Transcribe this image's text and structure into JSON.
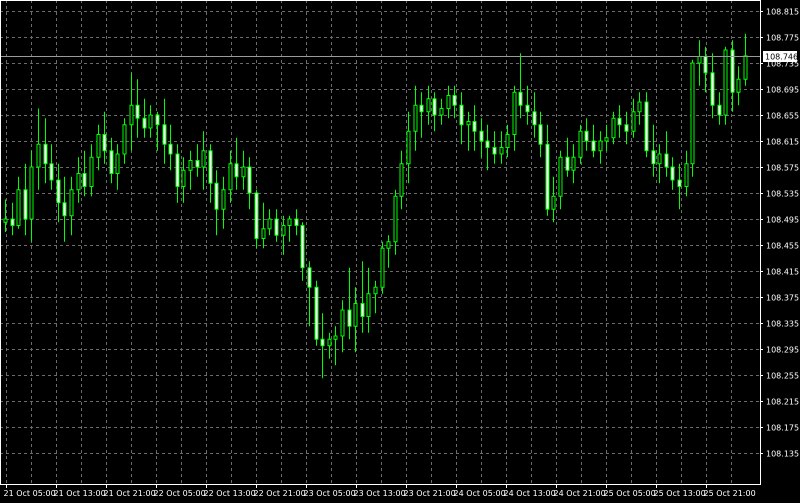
{
  "chart_data": {
    "type": "candlestick",
    "colors": {
      "background": "#000000",
      "grid": "#6b6b6b",
      "axis": "#ffffff",
      "bull_body": "#000000",
      "bull_outline": "#00ff00",
      "bear_body": "#ffffff",
      "bear_outline": "#00ff00",
      "wick": "#00ff00",
      "text": "#ffffff",
      "price_line": "#9a9a9a",
      "price_tag_bg": "#ffffff",
      "price_tag_text": "#000000"
    },
    "grid": true,
    "ylim": [
      108.135,
      108.815
    ],
    "y_ticks": [
      "108.815",
      "108.775",
      "108.735",
      "108.695",
      "108.655",
      "108.615",
      "108.575",
      "108.535",
      "108.495",
      "108.455",
      "108.415",
      "108.375",
      "108.335",
      "108.295",
      "108.255",
      "108.215",
      "108.175",
      "108.135"
    ],
    "x_ticks": [
      "21 Oct 05:00",
      "21 Oct 13:00",
      "21 Oct 21:00",
      "22 Oct 05:00",
      "22 Oct 13:00",
      "22 Oct 21:00",
      "23 Oct 05:00",
      "23 Oct 13:00",
      "23 Oct 21:00",
      "24 Oct 05:00",
      "24 Oct 13:00",
      "24 Oct 21:00",
      "25 Oct 05:00",
      "25 Oct 13:00",
      "25 Oct 21:00"
    ],
    "current_price": "108.746",
    "candles": [
      {
        "o": 108.49,
        "h": 108.525,
        "l": 108.475,
        "c": 108.495
      },
      {
        "o": 108.495,
        "h": 108.52,
        "l": 108.47,
        "c": 108.485
      },
      {
        "o": 108.485,
        "h": 108.56,
        "l": 108.48,
        "c": 108.54
      },
      {
        "o": 108.54,
        "h": 108.58,
        "l": 108.47,
        "c": 108.495
      },
      {
        "o": 108.495,
        "h": 108.6,
        "l": 108.46,
        "c": 108.575
      },
      {
        "o": 108.575,
        "h": 108.665,
        "l": 108.54,
        "c": 108.61
      },
      {
        "o": 108.61,
        "h": 108.65,
        "l": 108.55,
        "c": 108.58
      },
      {
        "o": 108.58,
        "h": 108.61,
        "l": 108.54,
        "c": 108.555
      },
      {
        "o": 108.555,
        "h": 108.58,
        "l": 108.49,
        "c": 108.52
      },
      {
        "o": 108.52,
        "h": 108.56,
        "l": 108.46,
        "c": 108.5
      },
      {
        "o": 108.5,
        "h": 108.56,
        "l": 108.47,
        "c": 108.54
      },
      {
        "o": 108.54,
        "h": 108.59,
        "l": 108.52,
        "c": 108.565
      },
      {
        "o": 108.565,
        "h": 108.6,
        "l": 108.53,
        "c": 108.545
      },
      {
        "o": 108.545,
        "h": 108.61,
        "l": 108.53,
        "c": 108.59
      },
      {
        "o": 108.59,
        "h": 108.64,
        "l": 108.57,
        "c": 108.625
      },
      {
        "o": 108.625,
        "h": 108.66,
        "l": 108.58,
        "c": 108.6
      },
      {
        "o": 108.6,
        "h": 108.62,
        "l": 108.55,
        "c": 108.565
      },
      {
        "o": 108.565,
        "h": 108.61,
        "l": 108.54,
        "c": 108.595
      },
      {
        "o": 108.595,
        "h": 108.65,
        "l": 108.58,
        "c": 108.64
      },
      {
        "o": 108.64,
        "h": 108.72,
        "l": 108.6,
        "c": 108.67
      },
      {
        "o": 108.67,
        "h": 108.71,
        "l": 108.62,
        "c": 108.65
      },
      {
        "o": 108.65,
        "h": 108.68,
        "l": 108.62,
        "c": 108.635
      },
      {
        "o": 108.635,
        "h": 108.67,
        "l": 108.62,
        "c": 108.655
      },
      {
        "o": 108.655,
        "h": 108.66,
        "l": 108.6,
        "c": 108.64
      },
      {
        "o": 108.64,
        "h": 108.68,
        "l": 108.58,
        "c": 108.61
      },
      {
        "o": 108.61,
        "h": 108.64,
        "l": 108.57,
        "c": 108.595
      },
      {
        "o": 108.595,
        "h": 108.61,
        "l": 108.52,
        "c": 108.545
      },
      {
        "o": 108.545,
        "h": 108.59,
        "l": 108.52,
        "c": 108.57
      },
      {
        "o": 108.57,
        "h": 108.6,
        "l": 108.54,
        "c": 108.585
      },
      {
        "o": 108.585,
        "h": 108.61,
        "l": 108.56,
        "c": 108.575
      },
      {
        "o": 108.575,
        "h": 108.63,
        "l": 108.54,
        "c": 108.6
      },
      {
        "o": 108.6,
        "h": 108.61,
        "l": 108.52,
        "c": 108.55
      },
      {
        "o": 108.55,
        "h": 108.57,
        "l": 108.47,
        "c": 108.51
      },
      {
        "o": 108.51,
        "h": 108.56,
        "l": 108.48,
        "c": 108.54
      },
      {
        "o": 108.54,
        "h": 108.6,
        "l": 108.52,
        "c": 108.58
      },
      {
        "o": 108.58,
        "h": 108.62,
        "l": 108.54,
        "c": 108.56
      },
      {
        "o": 108.56,
        "h": 108.6,
        "l": 108.54,
        "c": 108.575
      },
      {
        "o": 108.575,
        "h": 108.59,
        "l": 108.51,
        "c": 108.535
      },
      {
        "o": 108.535,
        "h": 108.54,
        "l": 108.45,
        "c": 108.465
      },
      {
        "o": 108.465,
        "h": 108.52,
        "l": 108.45,
        "c": 108.48
      },
      {
        "o": 108.48,
        "h": 108.51,
        "l": 108.47,
        "c": 108.495
      },
      {
        "o": 108.495,
        "h": 108.51,
        "l": 108.46,
        "c": 108.47
      },
      {
        "o": 108.47,
        "h": 108.5,
        "l": 108.44,
        "c": 108.485
      },
      {
        "o": 108.485,
        "h": 108.5,
        "l": 108.46,
        "c": 108.495
      },
      {
        "o": 108.495,
        "h": 108.51,
        "l": 108.47,
        "c": 108.485
      },
      {
        "o": 108.485,
        "h": 108.49,
        "l": 108.4,
        "c": 108.42
      },
      {
        "o": 108.42,
        "h": 108.43,
        "l": 108.33,
        "c": 108.39
      },
      {
        "o": 108.39,
        "h": 108.4,
        "l": 108.3,
        "c": 108.31
      },
      {
        "o": 108.31,
        "h": 108.35,
        "l": 108.25,
        "c": 108.3
      },
      {
        "o": 108.3,
        "h": 108.32,
        "l": 108.28,
        "c": 108.31
      },
      {
        "o": 108.31,
        "h": 108.33,
        "l": 108.27,
        "c": 108.315
      },
      {
        "o": 108.315,
        "h": 108.37,
        "l": 108.29,
        "c": 108.355
      },
      {
        "o": 108.355,
        "h": 108.42,
        "l": 108.31,
        "c": 108.33
      },
      {
        "o": 108.33,
        "h": 108.39,
        "l": 108.29,
        "c": 108.365
      },
      {
        "o": 108.365,
        "h": 108.43,
        "l": 108.32,
        "c": 108.345
      },
      {
        "o": 108.345,
        "h": 108.42,
        "l": 108.32,
        "c": 108.38
      },
      {
        "o": 108.38,
        "h": 108.4,
        "l": 108.35,
        "c": 108.39
      },
      {
        "o": 108.39,
        "h": 108.46,
        "l": 108.38,
        "c": 108.45
      },
      {
        "o": 108.45,
        "h": 108.47,
        "l": 108.42,
        "c": 108.46
      },
      {
        "o": 108.46,
        "h": 108.54,
        "l": 108.44,
        "c": 108.53
      },
      {
        "o": 108.53,
        "h": 108.6,
        "l": 108.51,
        "c": 108.58
      },
      {
        "o": 108.58,
        "h": 108.66,
        "l": 108.55,
        "c": 108.63
      },
      {
        "o": 108.63,
        "h": 108.7,
        "l": 108.6,
        "c": 108.67
      },
      {
        "o": 108.67,
        "h": 108.69,
        "l": 108.62,
        "c": 108.66
      },
      {
        "o": 108.66,
        "h": 108.7,
        "l": 108.64,
        "c": 108.68
      },
      {
        "o": 108.68,
        "h": 108.69,
        "l": 108.63,
        "c": 108.655
      },
      {
        "o": 108.655,
        "h": 108.68,
        "l": 108.64,
        "c": 108.665
      },
      {
        "o": 108.665,
        "h": 108.7,
        "l": 108.65,
        "c": 108.685
      },
      {
        "o": 108.685,
        "h": 108.7,
        "l": 108.65,
        "c": 108.67
      },
      {
        "o": 108.67,
        "h": 108.69,
        "l": 108.61,
        "c": 108.64
      },
      {
        "o": 108.64,
        "h": 108.66,
        "l": 108.6,
        "c": 108.645
      },
      {
        "o": 108.645,
        "h": 108.67,
        "l": 108.6,
        "c": 108.63
      },
      {
        "o": 108.63,
        "h": 108.65,
        "l": 108.59,
        "c": 108.615
      },
      {
        "o": 108.615,
        "h": 108.64,
        "l": 108.57,
        "c": 108.605
      },
      {
        "o": 108.605,
        "h": 108.63,
        "l": 108.58,
        "c": 108.595
      },
      {
        "o": 108.595,
        "h": 108.63,
        "l": 108.58,
        "c": 108.605
      },
      {
        "o": 108.605,
        "h": 108.64,
        "l": 108.59,
        "c": 108.625
      },
      {
        "o": 108.625,
        "h": 108.7,
        "l": 108.6,
        "c": 108.69
      },
      {
        "o": 108.69,
        "h": 108.75,
        "l": 108.65,
        "c": 108.67
      },
      {
        "o": 108.67,
        "h": 108.7,
        "l": 108.64,
        "c": 108.66
      },
      {
        "o": 108.66,
        "h": 108.69,
        "l": 108.62,
        "c": 108.64
      },
      {
        "o": 108.64,
        "h": 108.66,
        "l": 108.59,
        "c": 108.61
      },
      {
        "o": 108.61,
        "h": 108.64,
        "l": 108.5,
        "c": 108.51
      },
      {
        "o": 108.51,
        "h": 108.56,
        "l": 108.49,
        "c": 108.53
      },
      {
        "o": 108.53,
        "h": 108.6,
        "l": 108.51,
        "c": 108.59
      },
      {
        "o": 108.59,
        "h": 108.62,
        "l": 108.56,
        "c": 108.57
      },
      {
        "o": 108.57,
        "h": 108.61,
        "l": 108.55,
        "c": 108.59
      },
      {
        "o": 108.59,
        "h": 108.64,
        "l": 108.58,
        "c": 108.63
      },
      {
        "o": 108.63,
        "h": 108.65,
        "l": 108.6,
        "c": 108.615
      },
      {
        "o": 108.615,
        "h": 108.64,
        "l": 108.59,
        "c": 108.6
      },
      {
        "o": 108.6,
        "h": 108.63,
        "l": 108.58,
        "c": 108.615
      },
      {
        "o": 108.615,
        "h": 108.64,
        "l": 108.6,
        "c": 108.62
      },
      {
        "o": 108.62,
        "h": 108.66,
        "l": 108.61,
        "c": 108.65
      },
      {
        "o": 108.65,
        "h": 108.67,
        "l": 108.62,
        "c": 108.64
      },
      {
        "o": 108.64,
        "h": 108.66,
        "l": 108.61,
        "c": 108.63
      },
      {
        "o": 108.63,
        "h": 108.68,
        "l": 108.62,
        "c": 108.66
      },
      {
        "o": 108.66,
        "h": 108.69,
        "l": 108.64,
        "c": 108.675
      },
      {
        "o": 108.675,
        "h": 108.69,
        "l": 108.59,
        "c": 108.6
      },
      {
        "o": 108.6,
        "h": 108.64,
        "l": 108.56,
        "c": 108.58
      },
      {
        "o": 108.58,
        "h": 108.61,
        "l": 108.55,
        "c": 108.595
      },
      {
        "o": 108.595,
        "h": 108.63,
        "l": 108.56,
        "c": 108.575
      },
      {
        "o": 108.575,
        "h": 108.59,
        "l": 108.54,
        "c": 108.555
      },
      {
        "o": 108.555,
        "h": 108.58,
        "l": 108.51,
        "c": 108.545
      },
      {
        "o": 108.545,
        "h": 108.6,
        "l": 108.53,
        "c": 108.58
      },
      {
        "o": 108.58,
        "h": 108.74,
        "l": 108.56,
        "c": 108.735
      },
      {
        "o": 108.735,
        "h": 108.77,
        "l": 108.7,
        "c": 108.745
      },
      {
        "o": 108.745,
        "h": 108.76,
        "l": 108.69,
        "c": 108.72
      },
      {
        "o": 108.72,
        "h": 108.75,
        "l": 108.65,
        "c": 108.67
      },
      {
        "o": 108.67,
        "h": 108.69,
        "l": 108.64,
        "c": 108.655
      },
      {
        "o": 108.655,
        "h": 108.76,
        "l": 108.64,
        "c": 108.755
      },
      {
        "o": 108.755,
        "h": 108.77,
        "l": 108.66,
        "c": 108.69
      },
      {
        "o": 108.69,
        "h": 108.73,
        "l": 108.67,
        "c": 108.71
      },
      {
        "o": 108.71,
        "h": 108.78,
        "l": 108.7,
        "c": 108.746
      }
    ]
  }
}
